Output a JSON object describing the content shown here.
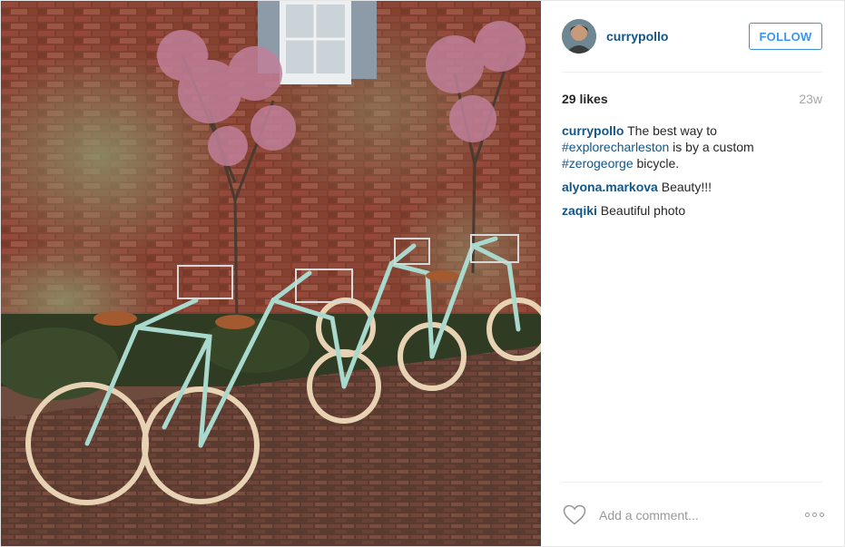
{
  "post": {
    "username": "currypollo",
    "follow_label": "FOLLOW",
    "likes": "29 likes",
    "age": "23w",
    "caption": {
      "author": "currypollo",
      "text_1": " The best way to ",
      "tag_1": "#explorecharleston",
      "text_2": " is by a custom ",
      "tag_2": "#zerogeorge",
      "text_3": " bicycle."
    },
    "comments": [
      {
        "author": "alyona.markova",
        "text": " Beauty!!!"
      },
      {
        "author": "zaqiki",
        "text": " Beautiful photo"
      }
    ],
    "comment_placeholder": "Add a comment...",
    "icons": {
      "like": "heart-icon",
      "more": "ellipsis-icon"
    }
  },
  "colors": {
    "link": "#125688",
    "follow": "#3897f0",
    "muted": "#a5a7aa",
    "bike": "#a9d8cd"
  }
}
